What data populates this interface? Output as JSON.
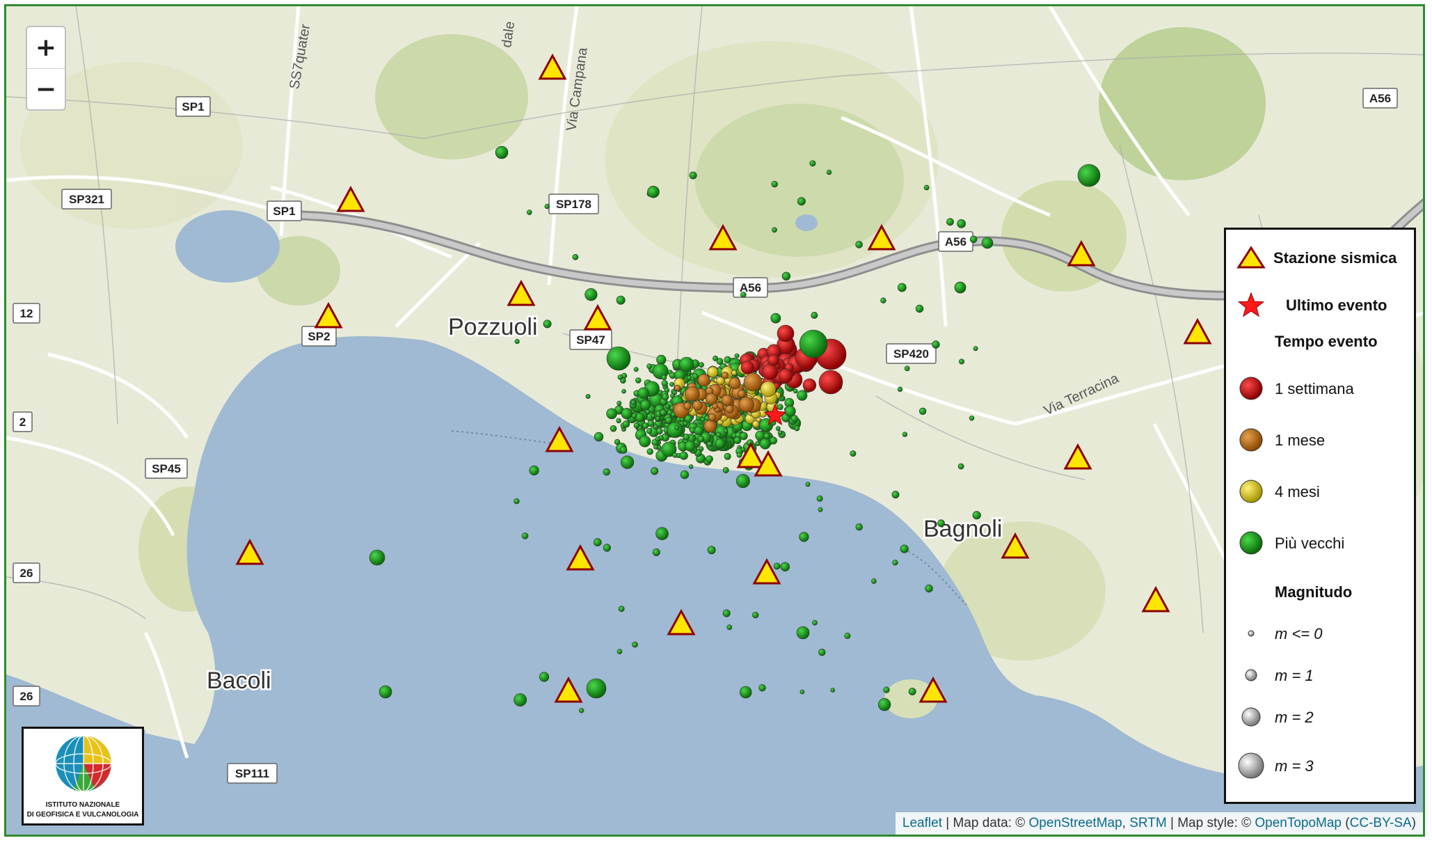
{
  "map": {
    "places": [
      {
        "id": "pozzuoli",
        "label": "Pozzuoli"
      },
      {
        "id": "bagnoli",
        "label": "Bagnoli"
      },
      {
        "id": "bacoli",
        "label": "Bacoli"
      }
    ],
    "roads": [
      {
        "id": "sp1a",
        "label": "SP1"
      },
      {
        "id": "sp1b",
        "label": "SP1"
      },
      {
        "id": "sp321",
        "label": "SP321"
      },
      {
        "id": "sp178",
        "label": "SP178"
      },
      {
        "id": "sp2",
        "label": "SP2"
      },
      {
        "id": "sp47",
        "label": "SP47"
      },
      {
        "id": "sp45",
        "label": "SP45"
      },
      {
        "id": "sp420",
        "label": "SP420"
      },
      {
        "id": "sp111",
        "label": "SP111"
      },
      {
        "id": "a56a",
        "label": "A56"
      },
      {
        "id": "a56b",
        "label": "A56"
      },
      {
        "id": "a56c",
        "label": "A56"
      },
      {
        "id": "r12",
        "label": "12"
      },
      {
        "id": "r2",
        "label": "2"
      },
      {
        "id": "r26a",
        "label": "26"
      },
      {
        "id": "r26b",
        "label": "26"
      }
    ],
    "streets": [
      {
        "id": "ss7",
        "label": "SS7quater"
      },
      {
        "id": "campana",
        "label": "Via Campana"
      },
      {
        "id": "dale",
        "label": "dale"
      },
      {
        "id": "terracina",
        "label": "Via Terracina"
      }
    ]
  },
  "zoom": {
    "in_label": "+",
    "out_label": "−"
  },
  "legend": {
    "station": "Stazione sismica",
    "last_event": "Ultimo evento",
    "time_title": "Tempo evento",
    "time_items": [
      {
        "label": "1 settimana",
        "color": "#c00000"
      },
      {
        "label": "1 mese",
        "color": "#c07818"
      },
      {
        "label": "4 mesi",
        "color": "#d8c818"
      },
      {
        "label": "Più vecchi",
        "color": "#22a022"
      }
    ],
    "mag_title": "Magnitudo",
    "mag_items": [
      {
        "label": "m <= 0"
      },
      {
        "label": "m = 1"
      },
      {
        "label": "m = 2"
      },
      {
        "label": "m = 3"
      }
    ]
  },
  "logo": {
    "line1": "ISTITUTO NAZIONALE",
    "line2": "DI GEOFISICA E VULCANOLOGIA"
  },
  "attribution": {
    "leaflet": "Leaflet",
    "sep1": " | Map data: © ",
    "osm": "OpenStreetMap",
    "comma": ", ",
    "srtm": "SRTM",
    "sep2": " | Map style: © ",
    "otm": "OpenTopoMap",
    "open": " (",
    "license": "CC-BY-SA",
    "close": ")"
  },
  "colors": {
    "week": "#c00000",
    "month": "#c07818",
    "four_months": "#d8c818",
    "older": "#22a022",
    "station_fill": "#ffe600",
    "station_stroke": "#8b0000",
    "sea": "#9fbad2",
    "land": "#e8ead8"
  }
}
